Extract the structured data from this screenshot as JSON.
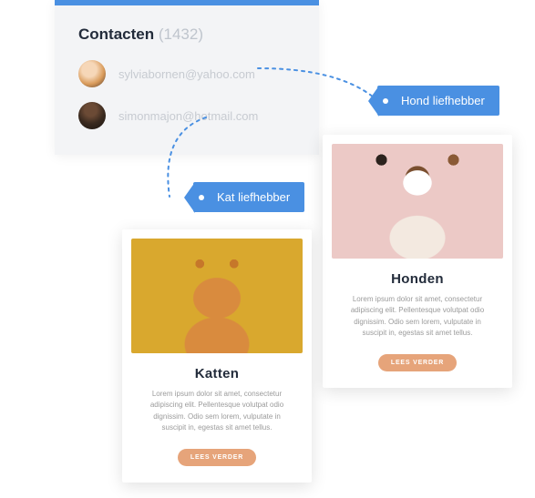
{
  "contacts": {
    "title": "Contacten",
    "count": "(1432)",
    "items": [
      {
        "email": "sylviabornen@yahoo.com"
      },
      {
        "email": "simonmajon@hotmail.com"
      }
    ]
  },
  "tags": {
    "hond": "Hond liefhebber",
    "kat": "Kat liefhebber"
  },
  "cards": {
    "honden": {
      "title": "Honden",
      "body": "Lorem ipsum dolor sit amet, consectetur adipiscing elit. Pellentesque volutpat odio dignissim. Odio sem lorem, vulputate in suscipit in, egestas sit amet tellus.",
      "cta": "LEES VERDER"
    },
    "katten": {
      "title": "Katten",
      "body": "Lorem ipsum dolor sit amet, consectetur adipiscing elit. Pellentesque volutpat odio dignissim. Odio sem lorem, vulputate in suscipit in, egestas sit amet tellus.",
      "cta": "LEES VERDER"
    }
  }
}
